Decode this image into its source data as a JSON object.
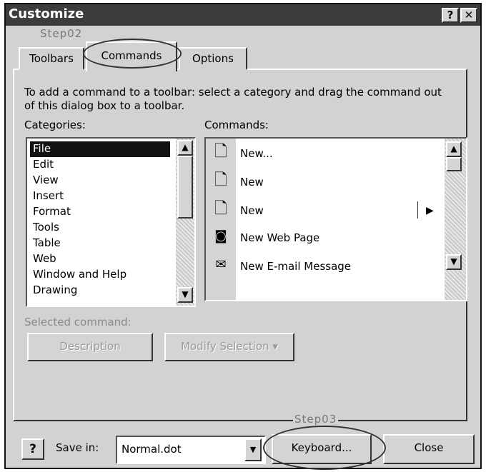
{
  "window": {
    "title": "Customize",
    "help_glyph": "?",
    "close_glyph": "✕"
  },
  "annotations": {
    "step02": "Step02",
    "step03": "Step03"
  },
  "tabs": [
    {
      "label": "Toolbars",
      "active": false
    },
    {
      "label": "Commands",
      "active": true
    },
    {
      "label": "Options",
      "active": false
    }
  ],
  "instructions": "To add a command to a toolbar: select a category and drag the command out of this dialog box to a toolbar.",
  "categories": {
    "label": "Categories:",
    "items": [
      "File",
      "Edit",
      "View",
      "Insert",
      "Format",
      "Tools",
      "Table",
      "Web",
      "Window and Help",
      "Drawing"
    ],
    "selected": "File"
  },
  "commands": {
    "label": "Commands:",
    "items": [
      {
        "label": "New...",
        "icon": "new-document-icon",
        "has_submenu": false
      },
      {
        "label": "New",
        "icon": "new-document-icon",
        "has_submenu": false
      },
      {
        "label": "New",
        "icon": "new-document-icon",
        "has_submenu": true
      },
      {
        "label": "New Web Page",
        "icon": "web-page-icon",
        "has_submenu": false
      },
      {
        "label": "New E-mail Message",
        "icon": "email-message-icon",
        "has_submenu": false
      }
    ]
  },
  "selected_command": {
    "label": "Selected command:",
    "description_button": "Description",
    "modify_button": "Modify Selection ▾"
  },
  "footer": {
    "help_glyph": "?",
    "save_in_label": "Save in:",
    "save_in_value": "Normal.dot",
    "keyboard_button": "Keyboard...",
    "close_button": "Close"
  }
}
